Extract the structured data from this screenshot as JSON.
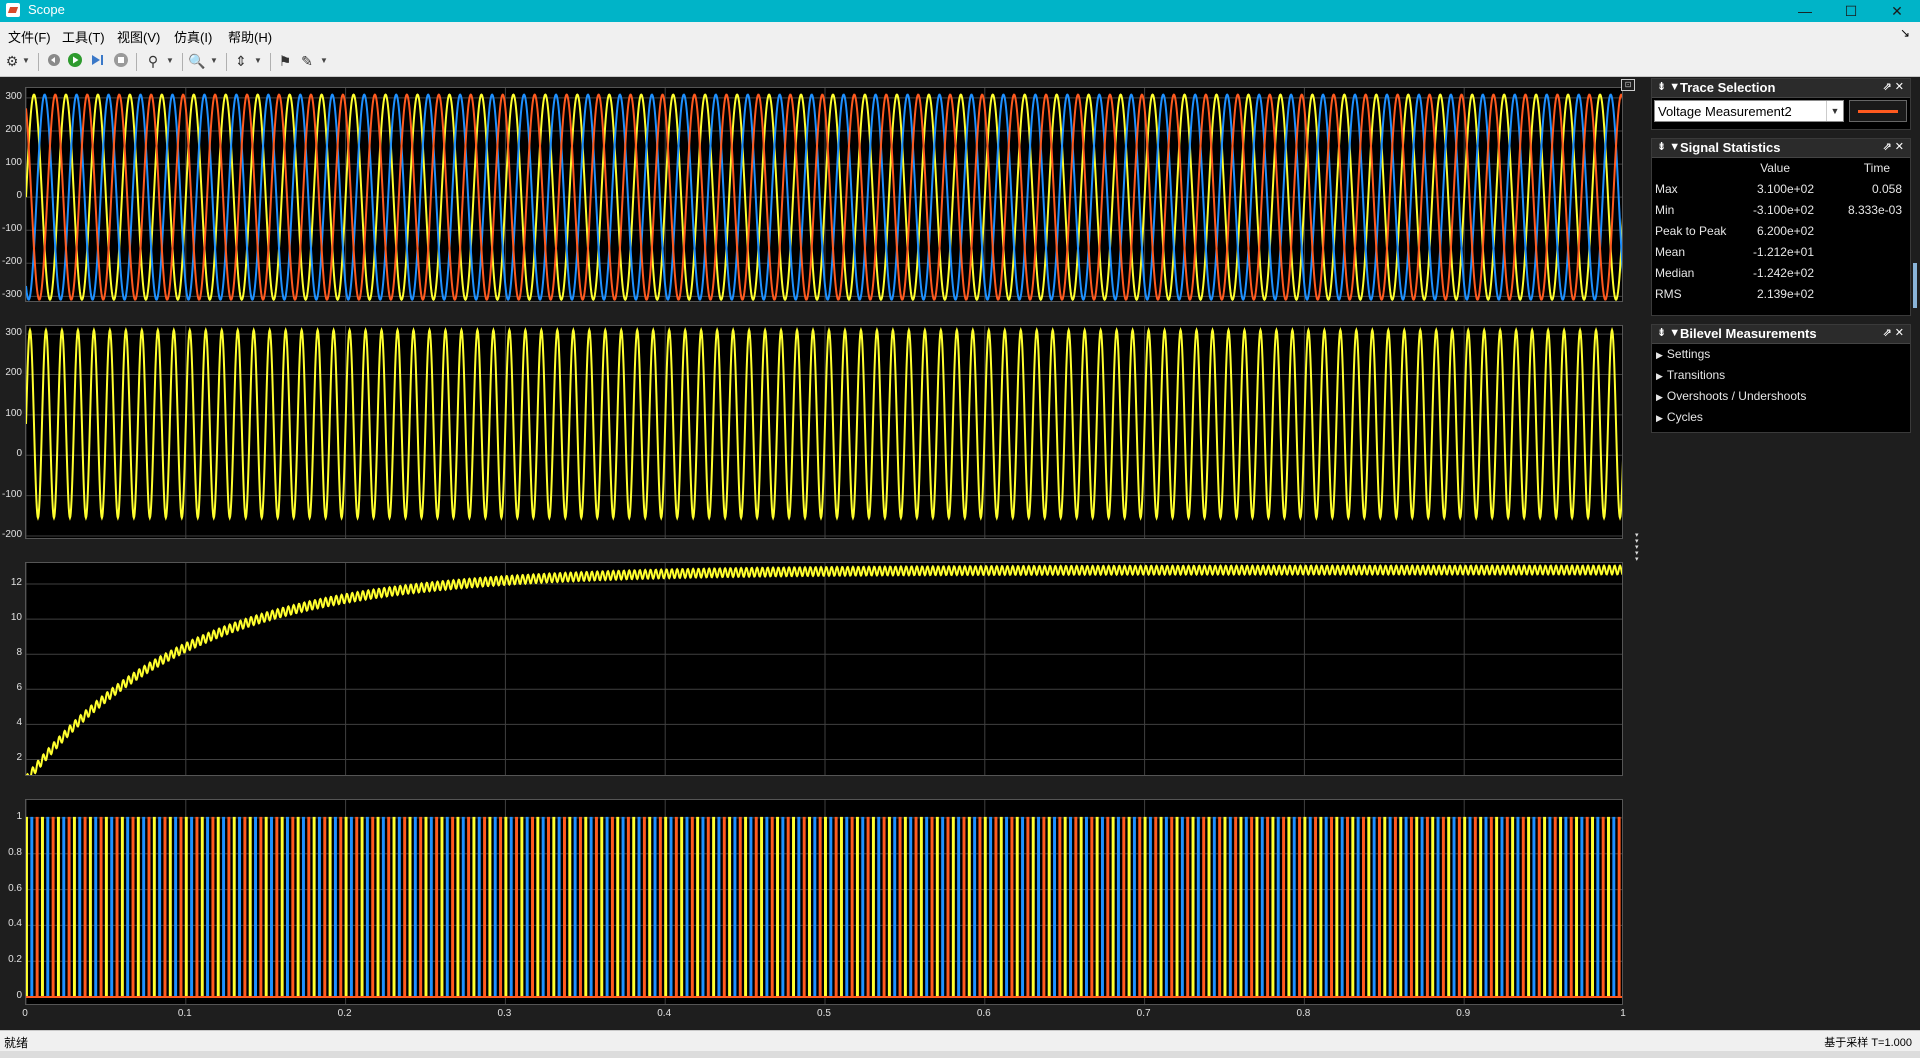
{
  "window": {
    "title": "Scope",
    "minimize": "—",
    "maximize": "☐",
    "close": "✕"
  },
  "menu": [
    "文件(F)",
    "工具(T)",
    "视图(V)",
    "仿真(I)",
    "帮助(H)"
  ],
  "toolbar": {
    "icons": [
      "gear-icon",
      "step-back-icon",
      "run-icon",
      "step-forward-icon",
      "stop-icon",
      "highlight-simulink-block-icon",
      "zoom-in-icon",
      "scale-axes-limits-icon",
      "triggers-icon",
      "measurements-icon"
    ]
  },
  "plots": {
    "time_label_x": [
      "0",
      "0.1",
      "0.2",
      "0.3",
      "0.4",
      "0.5",
      "0.6",
      "0.7",
      "0.8",
      "0.9",
      "1"
    ]
  },
  "colors": {
    "yellow": "#ffff2e",
    "blue": "#1e90ff",
    "orange": "#ff5a1f",
    "grid": "#404040",
    "bg": "#000000"
  },
  "chart_data": [
    {
      "type": "line",
      "x_range": [
        0,
        1
      ],
      "ylim": [
        -320,
        330
      ],
      "yticks": [
        "300",
        "200",
        "100",
        "0",
        "-100",
        "-200",
        "-300"
      ],
      "series": [
        {
          "color": "#ffff2e",
          "amplitude": 310,
          "frequency_hz": 50,
          "phase_deg": 0
        },
        {
          "color": "#1e90ff",
          "amplitude": 310,
          "frequency_hz": 50,
          "phase_deg": -120
        },
        {
          "color": "#ff5a1f",
          "amplitude": 310,
          "frequency_hz": 50,
          "phase_deg": 120
        }
      ]
    },
    {
      "type": "line",
      "x_range": [
        0,
        1
      ],
      "ylim": [
        -210,
        320
      ],
      "yticks": [
        "300",
        "200",
        "100",
        "0",
        "-100",
        "-200"
      ],
      "series": [
        {
          "color": "#ffff2e",
          "max": 310,
          "min": -155,
          "frequency_hz": 100
        }
      ]
    },
    {
      "type": "line",
      "x_range": [
        0,
        1
      ],
      "ylim": [
        1,
        13.2
      ],
      "yticks": [
        "12",
        "10",
        "8",
        "6",
        "4",
        "2"
      ],
      "series": [
        {
          "color": "#ffff2e",
          "start": 0.8,
          "final": 12.8,
          "time_constant_s": 0.1,
          "ripple": 0.25,
          "ripple_hz": 300
        }
      ]
    },
    {
      "type": "line",
      "x_range": [
        0,
        1
      ],
      "ylim": [
        -0.05,
        1.1
      ],
      "yticks": [
        "1",
        "0.8",
        "0.6",
        "0.4",
        "0.2",
        "0"
      ],
      "series": [
        {
          "color": "#ffff2e",
          "pulse_rate_hz": 100,
          "phase": 0.0
        },
        {
          "color": "#1e90ff",
          "pulse_rate_hz": 100,
          "phase": 0.333
        },
        {
          "color": "#ff5a1f",
          "pulse_rate_hz": 100,
          "phase": 0.667
        }
      ]
    }
  ],
  "trace_selection": {
    "title": "Trace Selection",
    "selected": "Voltage Measurement2",
    "swatch_color": "#ff5a1f"
  },
  "signal_statistics": {
    "title": "Signal Statistics",
    "headers": [
      "",
      "Value",
      "Time"
    ],
    "rows": [
      {
        "name": "Max",
        "value": "3.100e+02",
        "time": "0.058"
      },
      {
        "name": "Min",
        "value": "-3.100e+02",
        "time": "8.333e-03"
      },
      {
        "name": "Peak to Peak",
        "value": "6.200e+02",
        "time": ""
      },
      {
        "name": "Mean",
        "value": "-1.212e+01",
        "time": ""
      },
      {
        "name": "Median",
        "value": "-1.242e+02",
        "time": ""
      },
      {
        "name": "RMS",
        "value": "2.139e+02",
        "time": ""
      }
    ]
  },
  "bilevel": {
    "title": "Bilevel Measurements",
    "items": [
      "Settings",
      "Transitions",
      "Overshoots / Undershoots",
      "Cycles"
    ]
  },
  "status": {
    "left": "就绪",
    "right": "基于采样  T=1.000"
  }
}
